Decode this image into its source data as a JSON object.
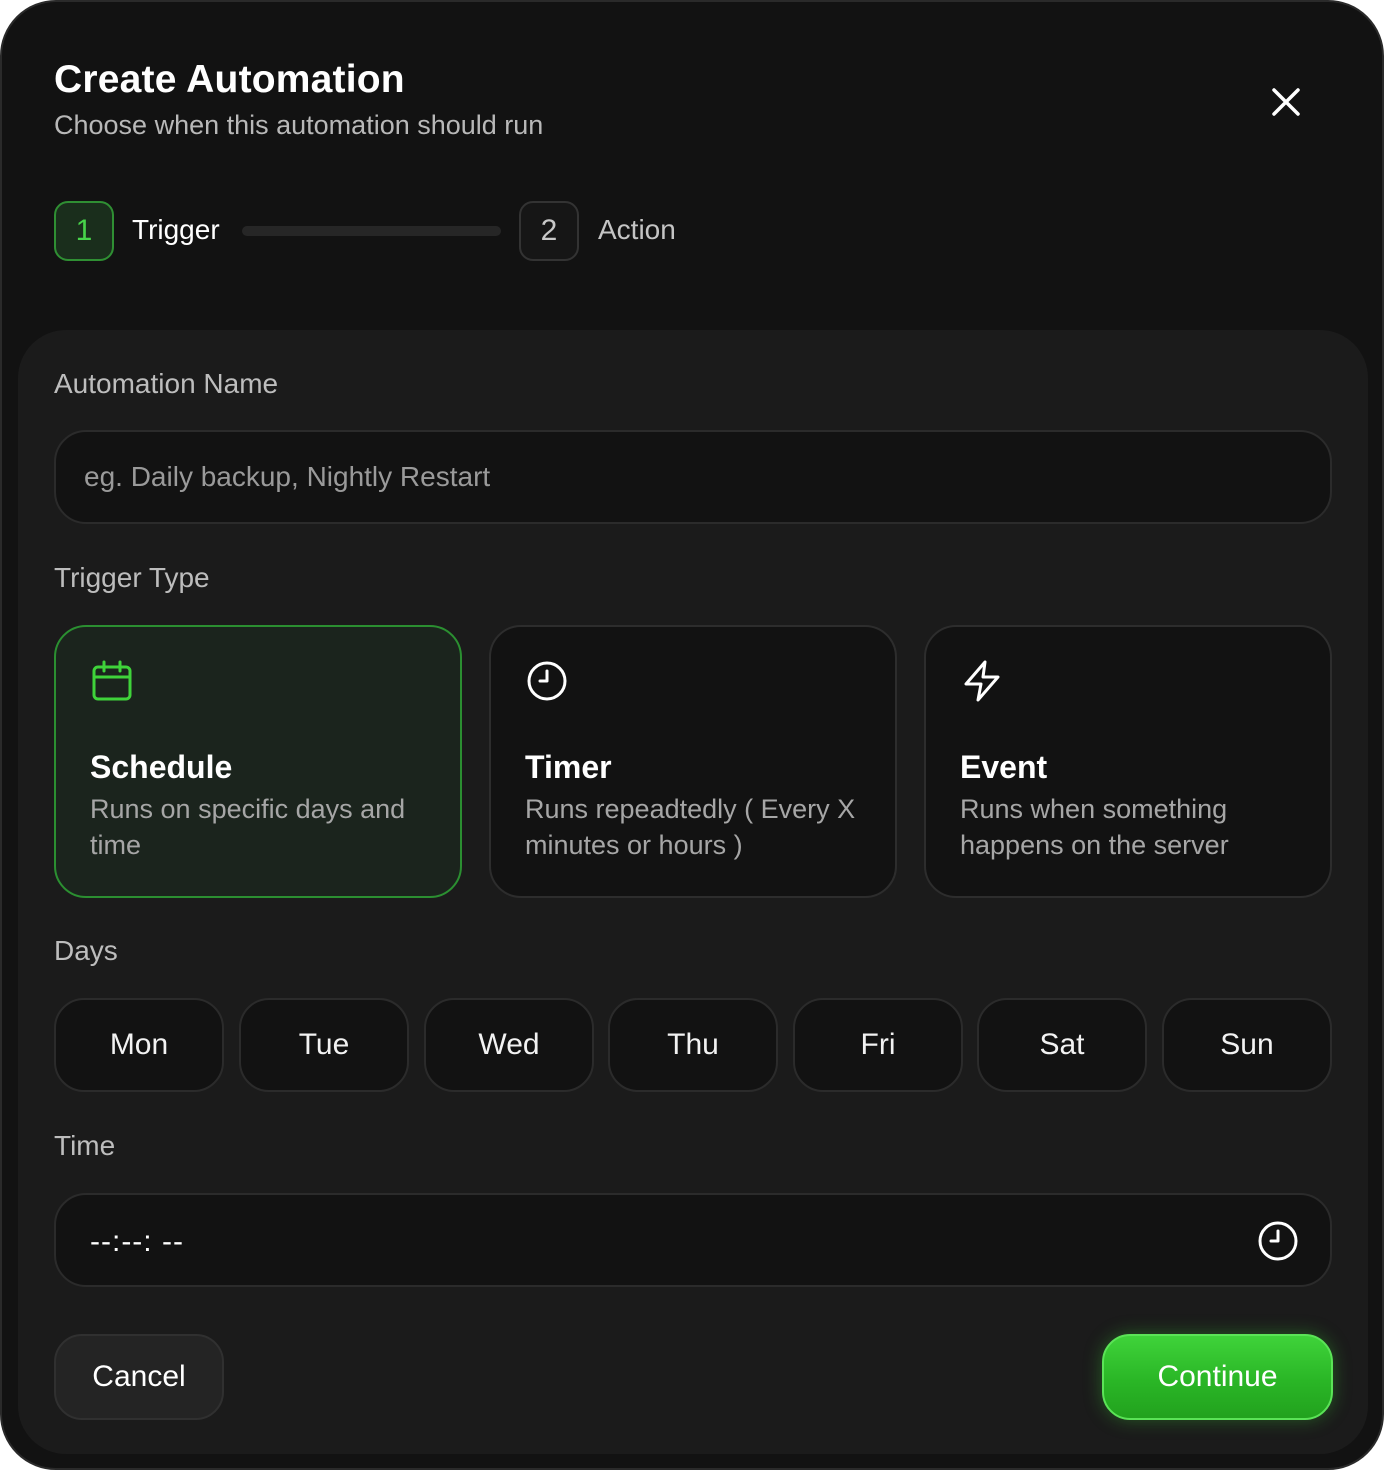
{
  "header": {
    "title": "Create Automation",
    "subtitle": "Choose when this automation should run"
  },
  "stepper": {
    "steps": [
      {
        "number": "1",
        "label": "Trigger",
        "active": true
      },
      {
        "number": "2",
        "label": "Action",
        "active": false
      }
    ]
  },
  "form": {
    "name_field": {
      "label": "Automation Name",
      "placeholder": "eg. Daily backup, Nightly Restart",
      "value": ""
    },
    "trigger_type": {
      "label": "Trigger Type",
      "selected": "Schedule",
      "options": [
        {
          "title": "Schedule",
          "description": "Runs on specific days and time",
          "icon": "calendar-icon"
        },
        {
          "title": "Timer",
          "description": "Runs repeadtedly ( Every X minutes or hours )",
          "icon": "clock-icon"
        },
        {
          "title": "Event",
          "description": "Runs when something happens on the server",
          "icon": "lightning-icon"
        }
      ]
    },
    "days": {
      "label": "Days",
      "options": [
        "Mon",
        "Tue",
        "Wed",
        "Thu",
        "Fri",
        "Sat",
        "Sun"
      ]
    },
    "time": {
      "label": "Time",
      "value": "--:--: --"
    }
  },
  "footer": {
    "cancel_label": "Cancel",
    "continue_label": "Continue"
  },
  "colors": {
    "background": "#121212",
    "panel": "#1b1b1b",
    "accent": "#2ab626",
    "accent_border": "#2b8f31"
  }
}
